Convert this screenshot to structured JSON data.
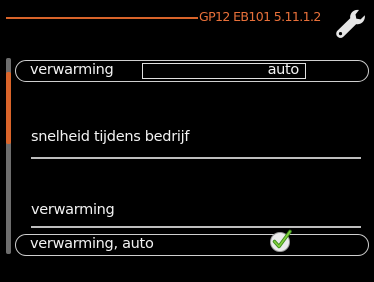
{
  "header": {
    "title": "GP12 EB101 5.11.1.2",
    "icon": "wrench-icon",
    "accent_color": "#d9642a"
  },
  "scrollbar": {
    "track_color": "#6d6d6d",
    "thumb_color": "#d9642a"
  },
  "rows": {
    "heating_mode": {
      "label": "verwarming",
      "value": "auto"
    },
    "speed_label": "snelheid tijdens bedrijf",
    "heating_label": "verwarming",
    "heating_auto": {
      "label": "verwarming, auto",
      "checked": true,
      "icon": "check-icon"
    }
  }
}
